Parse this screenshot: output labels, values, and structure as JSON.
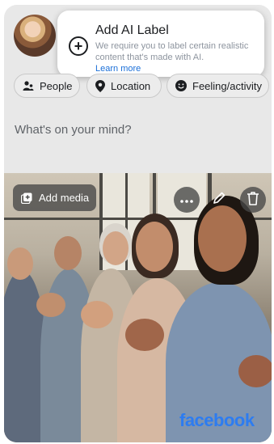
{
  "tooltip": {
    "title": "Add AI Label",
    "description": "We require you to label certain realistic content that's made with AI.",
    "link": "Learn more"
  },
  "chips": {
    "people": "People",
    "location": "Location",
    "feeling": "Feeling/activity"
  },
  "composer": {
    "placeholder": "What's on your mind?"
  },
  "media": {
    "add_label": "Add media"
  },
  "brand": {
    "logo_text": "facebook",
    "logo_color": "#2d7cf0"
  },
  "icons": {
    "plus": "plus-circle-icon",
    "people": "people-icon",
    "location": "location-pin-icon",
    "feeling": "smiley-icon",
    "add_media": "add-media-icon",
    "more": "more-icon",
    "edit": "pencil-icon",
    "delete": "trash-icon"
  }
}
